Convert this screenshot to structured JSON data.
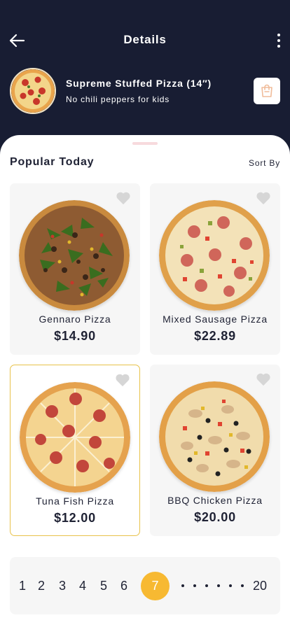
{
  "header": {
    "title": "Details"
  },
  "order": {
    "name": "Supreme Stuffed Pizza (14″)",
    "note": "No chili peppers for kids"
  },
  "section": {
    "title": "Popular Today",
    "sort_label": "Sort By"
  },
  "products": [
    {
      "name": "Gennaro Pizza",
      "price": "$14.90",
      "selected": false
    },
    {
      "name": "Mixed Sausage Pizza",
      "price": "$22.89",
      "selected": false
    },
    {
      "name": "Tuna Fish Pizza",
      "price": "$12.00",
      "selected": true
    },
    {
      "name": "BBQ Chicken Pizza",
      "price": "$20.00",
      "selected": false
    }
  ],
  "pagination": {
    "pages": [
      "1",
      "2",
      "3",
      "4",
      "5",
      "6"
    ],
    "current": "7",
    "last": "20"
  },
  "colors": {
    "header_bg": "#181d33",
    "accent": "#f7b932",
    "selected_border": "#e8c24a"
  },
  "icons": {
    "back": "arrow-left-icon",
    "more": "more-vertical-icon",
    "cart": "shopping-bag-icon",
    "favorite": "heart-icon"
  }
}
